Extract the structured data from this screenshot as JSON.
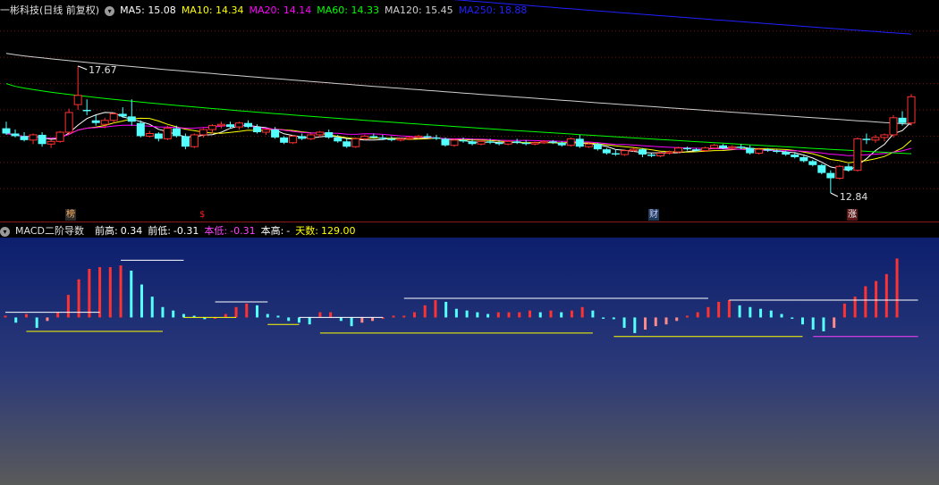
{
  "upper": {
    "title": "一彬科技(日线 前复权)",
    "ma": [
      {
        "label": "MA5: ",
        "value": "15.08",
        "color": "#ffffff"
      },
      {
        "label": "MA10: ",
        "value": "14.34",
        "color": "#ffff00"
      },
      {
        "label": "MA20: ",
        "value": "14.14",
        "color": "#ff00ff"
      },
      {
        "label": "MA60: ",
        "value": "14.33",
        "color": "#00ff00"
      },
      {
        "label": "MA120: ",
        "value": "15.45",
        "color": "#d0d0d0"
      },
      {
        "label": "MA250: ",
        "value": "18.88",
        "color": "#2020ff"
      }
    ],
    "high_label": "17.67",
    "low_label": "12.84",
    "markers": [
      "榜",
      "$",
      "财",
      "涨"
    ]
  },
  "lower": {
    "title": "MACD二阶导数",
    "items": [
      {
        "label": "前高:",
        "value": "0.34",
        "color": "#ffffff"
      },
      {
        "label": "前低:",
        "value": "-0.31",
        "color": "#ffffff"
      },
      {
        "label": "本低:",
        "value": "-0.31",
        "color": "#ff40ff"
      },
      {
        "label": "本高:",
        "value": "-",
        "color": "#ffffff"
      },
      {
        "label": "天数:",
        "value": "129.00",
        "color": "#ffff00"
      }
    ]
  },
  "colors": {
    "up": "#ff3232",
    "down": "#54ffff",
    "down_light": "#ff8a8a",
    "ma5": "#ffffff",
    "ma10": "#ffff00",
    "ma20": "#ff00ff",
    "ma60": "#00ff00",
    "ma120": "#d0d0d0",
    "ma250": "#2020ff"
  },
  "chart_data": [
    {
      "type": "candlestick",
      "title": "一彬科技(日线 前复权)",
      "ylim": [
        12.5,
        19.5
      ],
      "annotations": {
        "high": 17.67,
        "low": 12.84
      },
      "candles": [
        [
          15.3,
          15.55,
          15.05,
          15.1
        ],
        [
          15.1,
          15.25,
          14.95,
          15.0
        ],
        [
          15.0,
          15.15,
          14.8,
          14.85
        ],
        [
          14.85,
          15.1,
          14.7,
          15.05
        ],
        [
          15.05,
          15.15,
          14.6,
          14.7
        ],
        [
          14.7,
          14.85,
          14.55,
          14.8
        ],
        [
          14.8,
          15.2,
          14.75,
          15.15
        ],
        [
          15.15,
          16.05,
          15.05,
          15.9
        ],
        [
          16.2,
          17.67,
          16.0,
          16.55
        ],
        [
          16.0,
          16.4,
          15.8,
          15.95
        ],
        [
          15.6,
          15.8,
          15.4,
          15.5
        ],
        [
          15.45,
          15.7,
          15.3,
          15.6
        ],
        [
          15.6,
          15.9,
          15.5,
          15.85
        ],
        [
          15.85,
          16.1,
          15.7,
          15.75
        ],
        [
          15.75,
          16.4,
          15.4,
          15.55
        ],
        [
          15.5,
          15.6,
          14.95,
          15.0
        ],
        [
          15.0,
          15.2,
          14.95,
          15.1
        ],
        [
          15.1,
          15.15,
          14.8,
          14.9
        ],
        [
          14.9,
          15.4,
          14.85,
          15.3
        ],
        [
          15.3,
          15.4,
          14.95,
          15.0
        ],
        [
          15.0,
          15.1,
          14.5,
          14.6
        ],
        [
          14.6,
          15.1,
          14.55,
          15.05
        ],
        [
          15.05,
          15.3,
          14.95,
          15.25
        ],
        [
          15.25,
          15.45,
          15.1,
          15.4
        ],
        [
          15.4,
          15.55,
          15.3,
          15.45
        ],
        [
          15.45,
          15.55,
          15.3,
          15.35
        ],
        [
          15.35,
          15.55,
          15.25,
          15.5
        ],
        [
          15.5,
          15.6,
          15.3,
          15.35
        ],
        [
          15.35,
          15.45,
          15.1,
          15.15
        ],
        [
          15.15,
          15.3,
          15.05,
          15.25
        ],
        [
          15.25,
          15.35,
          14.9,
          14.95
        ],
        [
          14.95,
          15.0,
          14.7,
          14.75
        ],
        [
          14.75,
          15.05,
          14.7,
          15.0
        ],
        [
          15.0,
          15.1,
          14.85,
          14.9
        ],
        [
          14.9,
          15.1,
          14.85,
          15.05
        ],
        [
          15.05,
          15.2,
          14.95,
          15.15
        ],
        [
          15.15,
          15.25,
          14.9,
          14.95
        ],
        [
          14.95,
          15.05,
          14.75,
          14.8
        ],
        [
          14.8,
          14.9,
          14.55,
          14.6
        ],
        [
          14.6,
          14.95,
          14.55,
          14.9
        ],
        [
          14.9,
          15.05,
          14.85,
          15.0
        ],
        [
          15.0,
          15.1,
          14.9,
          14.95
        ],
        [
          14.95,
          15.05,
          14.85,
          14.9
        ],
        [
          14.9,
          15.0,
          14.8,
          14.85
        ],
        [
          14.85,
          14.95,
          14.8,
          14.9
        ],
        [
          14.9,
          15.0,
          14.85,
          14.95
        ],
        [
          14.95,
          15.05,
          14.9,
          15.0
        ],
        [
          15.0,
          15.1,
          14.9,
          14.95
        ],
        [
          14.95,
          15.05,
          14.85,
          14.9
        ],
        [
          14.9,
          14.95,
          14.6,
          14.65
        ],
        [
          14.65,
          14.9,
          14.6,
          14.85
        ],
        [
          14.85,
          14.95,
          14.75,
          14.8
        ],
        [
          14.8,
          14.9,
          14.65,
          14.7
        ],
        [
          14.7,
          14.85,
          14.65,
          14.8
        ],
        [
          14.8,
          14.9,
          14.7,
          14.75
        ],
        [
          14.75,
          14.85,
          14.65,
          14.7
        ],
        [
          14.7,
          14.85,
          14.65,
          14.8
        ],
        [
          14.8,
          14.9,
          14.7,
          14.75
        ],
        [
          14.75,
          14.85,
          14.65,
          14.7
        ],
        [
          14.7,
          14.8,
          14.65,
          14.75
        ],
        [
          14.75,
          14.85,
          14.7,
          14.8
        ],
        [
          14.8,
          14.85,
          14.7,
          14.75
        ],
        [
          14.75,
          14.8,
          14.6,
          14.65
        ],
        [
          14.65,
          14.95,
          14.6,
          14.9
        ],
        [
          14.9,
          15.05,
          14.55,
          14.6
        ],
        [
          14.6,
          14.75,
          14.55,
          14.7
        ],
        [
          14.7,
          14.75,
          14.45,
          14.5
        ],
        [
          14.5,
          14.55,
          14.3,
          14.35
        ],
        [
          14.35,
          14.5,
          14.25,
          14.3
        ],
        [
          14.3,
          14.5,
          14.25,
          14.45
        ],
        [
          14.45,
          14.55,
          14.4,
          14.5
        ],
        [
          14.5,
          14.55,
          14.2,
          14.3
        ],
        [
          14.3,
          14.35,
          14.2,
          14.25
        ],
        [
          14.25,
          14.4,
          14.2,
          14.35
        ],
        [
          14.35,
          14.45,
          14.3,
          14.4
        ],
        [
          14.4,
          14.6,
          14.35,
          14.55
        ],
        [
          14.55,
          14.6,
          14.45,
          14.5
        ],
        [
          14.5,
          14.55,
          14.4,
          14.45
        ],
        [
          14.45,
          14.6,
          14.4,
          14.55
        ],
        [
          14.55,
          14.7,
          14.5,
          14.65
        ],
        [
          14.65,
          14.7,
          14.5,
          14.55
        ],
        [
          14.55,
          14.65,
          14.5,
          14.6
        ],
        [
          14.6,
          14.7,
          14.5,
          14.55
        ],
        [
          14.55,
          14.65,
          14.3,
          14.35
        ],
        [
          14.35,
          14.55,
          14.3,
          14.5
        ],
        [
          14.5,
          14.55,
          14.4,
          14.45
        ],
        [
          14.45,
          14.5,
          14.35,
          14.4
        ],
        [
          14.4,
          14.45,
          14.25,
          14.3
        ],
        [
          14.3,
          14.4,
          14.15,
          14.2
        ],
        [
          14.2,
          14.25,
          14.0,
          14.05
        ],
        [
          14.05,
          14.1,
          13.85,
          13.9
        ],
        [
          13.9,
          13.95,
          13.55,
          13.6
        ],
        [
          13.6,
          13.7,
          12.84,
          13.4
        ],
        [
          13.4,
          13.9,
          13.35,
          13.85
        ],
        [
          13.85,
          13.95,
          13.65,
          13.7
        ],
        [
          13.7,
          14.95,
          13.65,
          14.9
        ],
        [
          14.9,
          15.1,
          14.7,
          14.85
        ],
        [
          14.85,
          15.05,
          14.75,
          14.95
        ],
        [
          14.95,
          15.1,
          14.8,
          15.05
        ],
        [
          15.05,
          15.8,
          14.95,
          15.7
        ],
        [
          15.7,
          15.95,
          15.4,
          15.5
        ],
        [
          15.5,
          16.6,
          15.4,
          16.5
        ]
      ],
      "ma_series": [
        {
          "name": "MA5",
          "start": [
            0,
            15.1
          ],
          "end": [
            101,
            15.08
          ]
        },
        {
          "name": "MA10",
          "start": [
            0,
            15.05
          ],
          "end": [
            101,
            14.34
          ]
        },
        {
          "name": "MA20",
          "start": [
            0,
            15.4
          ],
          "end": [
            101,
            14.14
          ]
        },
        {
          "name": "MA60",
          "start": [
            0,
            17.0
          ],
          "end": [
            101,
            14.33
          ]
        },
        {
          "name": "MA120",
          "start": [
            0,
            18.15
          ],
          "end": [
            101,
            15.45
          ]
        },
        {
          "name": "MA250",
          "start": [
            0,
            21.8
          ],
          "end": [
            101,
            18.88
          ]
        }
      ]
    },
    {
      "type": "bar",
      "title": "MACD二阶导数",
      "ylim": [
        -0.95,
        0.45
      ],
      "values": [
        0.01,
        -0.03,
        0.02,
        -0.06,
        -0.02,
        0.03,
        0.13,
        0.22,
        0.28,
        0.29,
        0.29,
        0.3,
        0.27,
        0.19,
        0.12,
        0.06,
        0.04,
        0.02,
        0.01,
        -0.01,
        0.0,
        0.02,
        0.06,
        0.08,
        0.07,
        0.02,
        0.01,
        -0.02,
        -0.03,
        -0.04,
        0.03,
        0.03,
        -0.02,
        -0.05,
        -0.03,
        -0.02,
        0.0,
        0.01,
        0.01,
        0.03,
        0.07,
        0.1,
        0.09,
        0.05,
        0.04,
        0.03,
        0.02,
        0.03,
        0.03,
        0.03,
        0.04,
        0.03,
        0.04,
        0.03,
        0.04,
        0.06,
        0.04,
        0.0,
        -0.01,
        -0.06,
        -0.09,
        -0.07,
        -0.05,
        -0.04,
        -0.02,
        0.01,
        0.03,
        0.06,
        0.09,
        0.1,
        0.07,
        0.06,
        0.05,
        0.04,
        0.02,
        0.0,
        -0.04,
        -0.07,
        -0.08,
        -0.06,
        0.08,
        0.12,
        0.18,
        0.21,
        0.25,
        0.34
      ]
    }
  ]
}
